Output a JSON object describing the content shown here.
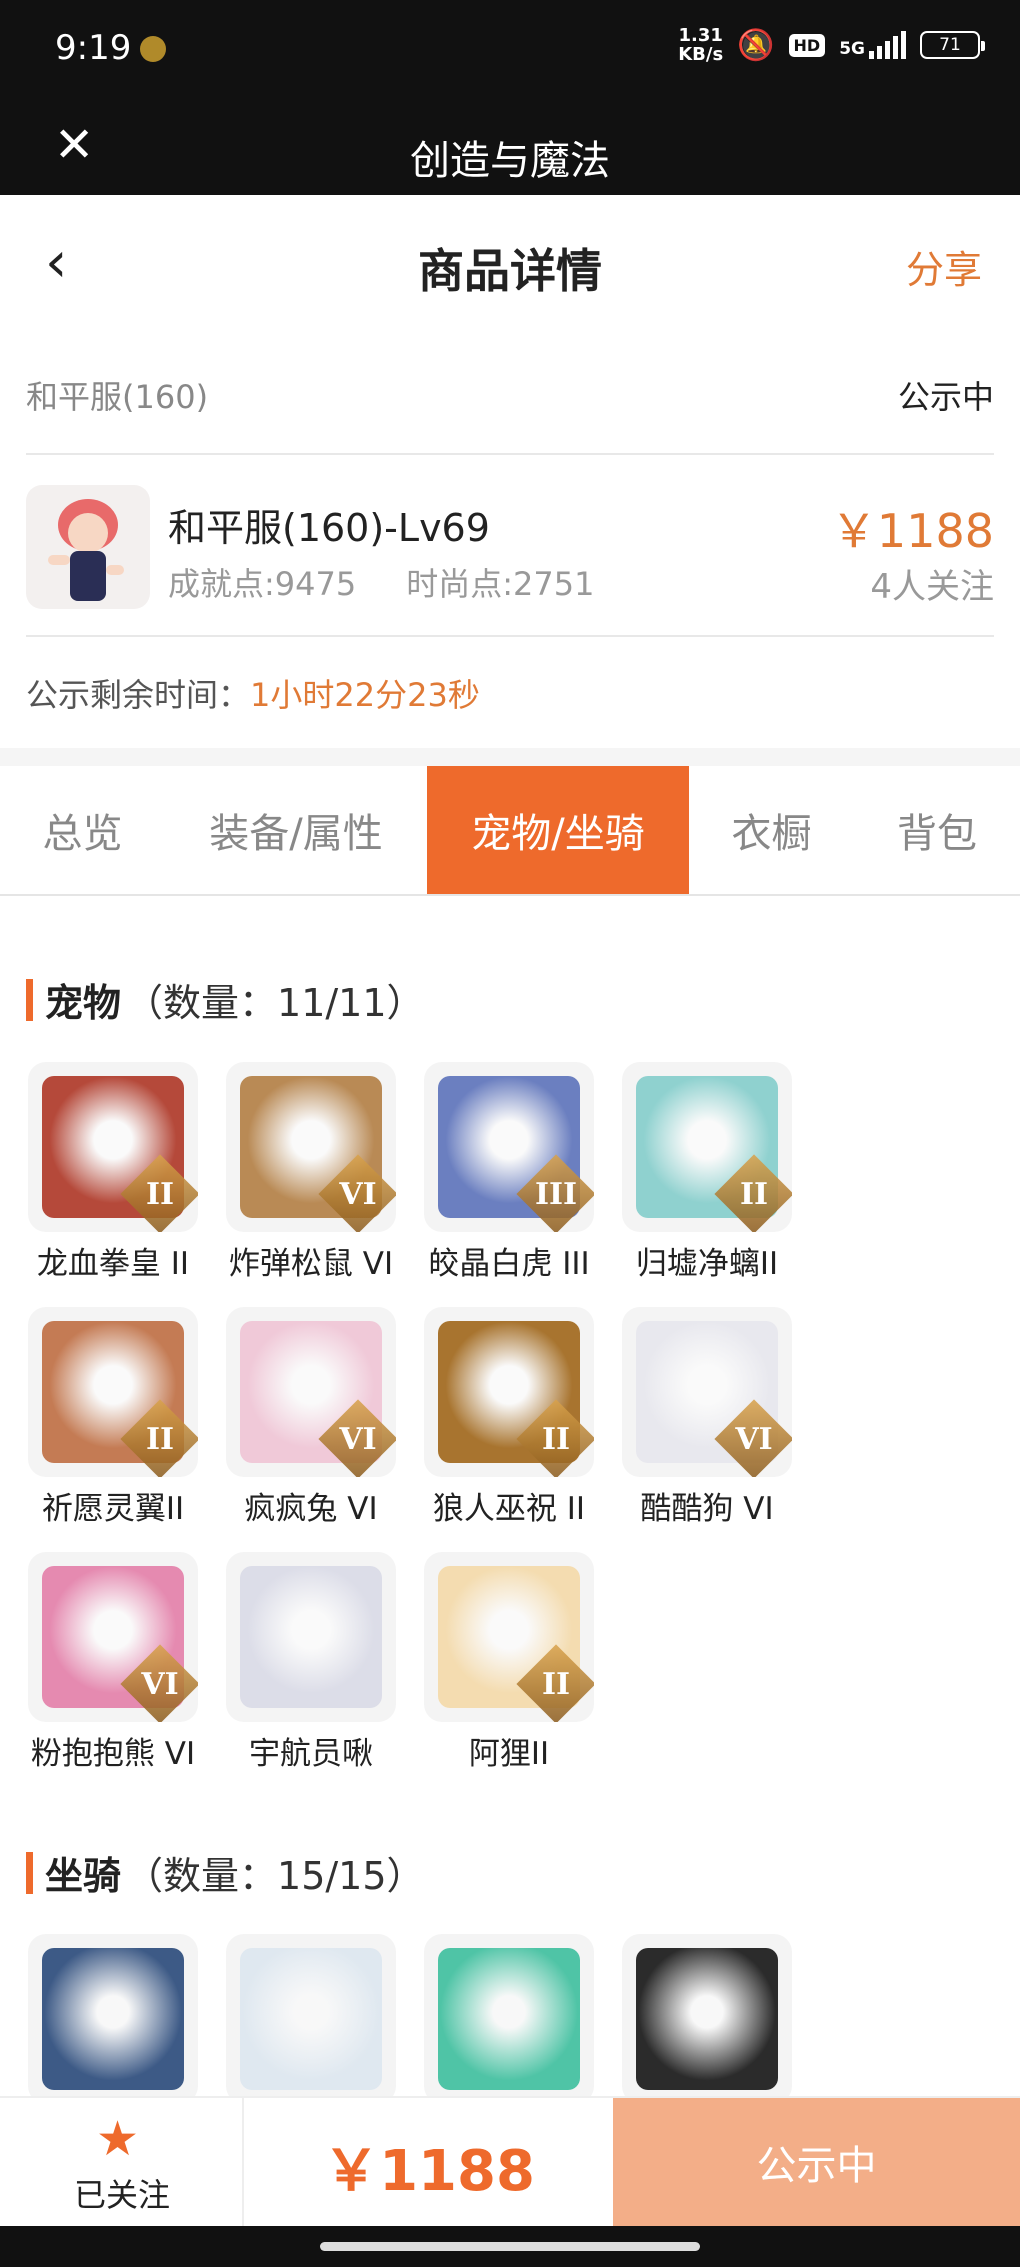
{
  "status_bar": {
    "time": "9:19",
    "net_speed_top": "1.31",
    "net_speed_bottom": "KB/s",
    "hd": "HD",
    "network": "5G",
    "battery": "71"
  },
  "title_bar": {
    "title": "创造与魔法"
  },
  "nav": {
    "title": "商品详情",
    "share": "分享"
  },
  "server": {
    "name": "和平服(160)",
    "status": "公示中"
  },
  "item": {
    "name": "和平服(160)-Lv69",
    "achievement": "成就点:9475",
    "fashion": "时尚点:2751",
    "price": "￥1188",
    "watchers": "4人关注"
  },
  "timer": {
    "label": "公示剩余时间：",
    "value": "1小时22分23秒"
  },
  "tabs": [
    {
      "label": "总览"
    },
    {
      "label": "装备/属性"
    },
    {
      "label": "宠物/坐骑"
    },
    {
      "label": "衣橱"
    },
    {
      "label": "背包"
    }
  ],
  "pets": {
    "title": "宠物",
    "count": "（数量：11/11）",
    "items": [
      {
        "label": "龙血拳皇 II",
        "tier": "II",
        "color": "#b5493a"
      },
      {
        "label": "炸弹松鼠 VI",
        "tier": "VI",
        "color": "#b98a55"
      },
      {
        "label": "皎晶白虎 III",
        "tier": "III",
        "color": "#6b7fc0"
      },
      {
        "label": "归墟净螭II",
        "tier": "II",
        "color": "#8fd1cf"
      },
      {
        "label": "祈愿灵翼II",
        "tier": "II",
        "color": "#c47b54"
      },
      {
        "label": "疯疯兔 VI",
        "tier": "VI",
        "color": "#f0c9d8"
      },
      {
        "label": "狼人巫祝 II",
        "tier": "II",
        "color": "#a8742f"
      },
      {
        "label": "酷酷狗 VI",
        "tier": "VI",
        "color": "#e8e8ee"
      },
      {
        "label": "粉抱抱熊 VI",
        "tier": "VI",
        "color": "#e58ab0"
      },
      {
        "label": "宇航员啾",
        "tier": "",
        "color": "#dcdde8"
      },
      {
        "label": "阿狸II",
        "tier": "II",
        "color": "#f4dcb0"
      }
    ]
  },
  "mounts": {
    "title": "坐骑",
    "count": "（数量：15/15）",
    "items": [
      {
        "color": "#3d5a86"
      },
      {
        "color": "#dfe8f0"
      },
      {
        "color": "#4fc4a6"
      },
      {
        "color": "#2b2b2b"
      },
      {
        "color": "#b9b9b9"
      }
    ]
  },
  "bottom": {
    "follow_label": "已关注",
    "price": "￥1188",
    "action": "公示中"
  },
  "colors": {
    "accent": "#ee6a2c",
    "price": "#e07a36",
    "action_bg": "#f3ae88"
  }
}
